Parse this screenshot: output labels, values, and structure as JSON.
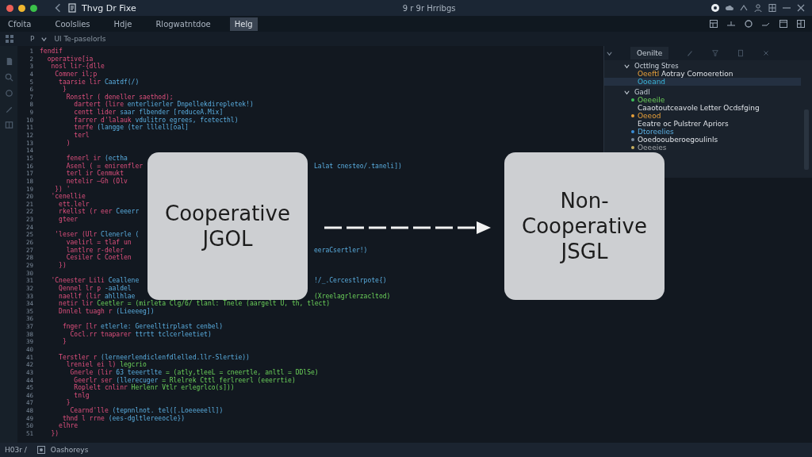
{
  "window": {
    "title": "Thvg Dr Fixe",
    "subtitle": "9 r 9r Hrribgs"
  },
  "menu": [
    {
      "label": "Cfoita",
      "selected": false
    },
    {
      "label": "Coolslies",
      "selected": false
    },
    {
      "label": "Hdje",
      "selected": false
    },
    {
      "label": "Rlogwatntdoe",
      "selected": false
    },
    {
      "label": "Helg",
      "selected": true
    }
  ],
  "toolbar": {
    "marker": "P",
    "breadcrumb": "Ul Te-paselorls"
  },
  "editor": {
    "lines": [
      {
        "number": "1",
        "parts": [
          {
            "text": "fendif",
            "kind": "keyword"
          }
        ]
      },
      {
        "number": "2",
        "parts": [
          {
            "text": "  operative[ia",
            "kind": "keyword"
          }
        ]
      },
      {
        "number": "3",
        "parts": [
          {
            "text": "   nosl lir-{dlle",
            "kind": "keyword"
          }
        ]
      },
      {
        "number": "4",
        "parts": [
          {
            "text": "    Comner il;p",
            "kind": "keyword"
          }
        ]
      },
      {
        "number": "5",
        "parts": [
          {
            "text": "     taarsie lir ",
            "kind": "keyword"
          },
          {
            "text": "Caatdf(/)",
            "kind": "string"
          }
        ]
      },
      {
        "number": "6",
        "parts": [
          {
            "text": "      }",
            "kind": "keyword"
          }
        ]
      },
      {
        "number": "7",
        "parts": [
          {
            "text": "       Ronstlr ( deneller saethod);",
            "kind": "keyword"
          }
        ]
      },
      {
        "number": "8",
        "parts": [
          {
            "text": "         dartert (lire ",
            "kind": "keyword"
          },
          {
            "text": "enterlierler Dnpellekdirepletek!)",
            "kind": "string"
          }
        ]
      },
      {
        "number": "9",
        "parts": [
          {
            "text": "         centt lider ",
            "kind": "keyword"
          },
          {
            "text": "saar flbender [reduceA.Mix]",
            "kind": "string"
          }
        ]
      },
      {
        "number": "10",
        "parts": [
          {
            "text": "         farrer d'lalauk ",
            "kind": "keyword"
          },
          {
            "text": "vdulitro egrees, fcetecthl)",
            "kind": "string"
          }
        ]
      },
      {
        "number": "11",
        "parts": [
          {
            "text": "         tnrfe ",
            "kind": "keyword"
          },
          {
            "text": "(langge (ter lllell[oal]",
            "kind": "string"
          }
        ]
      },
      {
        "number": "12",
        "parts": [
          {
            "text": "         terl",
            "kind": "keyword"
          }
        ]
      },
      {
        "number": "13",
        "parts": [
          {
            "text": "       )",
            "kind": "keyword"
          }
        ]
      },
      {
        "number": "14"
      },
      {
        "number": "15",
        "parts": [
          {
            "text": "       fenerl ir ",
            "kind": "keyword"
          },
          {
            "text": "(ectha",
            "kind": "string"
          }
        ]
      },
      {
        "number": "16",
        "parts": [
          {
            "text": "       Asenl ( = enirenfler",
            "kind": "keyword"
          }
        ],
        "tail": [
          {
            "text": "Lalat cnesteo/.taneli])",
            "kind": "string"
          }
        ]
      },
      {
        "number": "17",
        "parts": [
          {
            "text": "       terl ir Cenmukt",
            "kind": "keyword"
          }
        ]
      },
      {
        "number": "18",
        "parts": [
          {
            "text": "       netelir —Gh (Olv",
            "kind": "keyword"
          }
        ]
      },
      {
        "number": "19",
        "parts": [
          {
            "text": "    }) '",
            "kind": "keyword"
          }
        ]
      },
      {
        "number": "20",
        "parts": [
          {
            "text": "   'cenellie",
            "kind": "keyword"
          }
        ]
      },
      {
        "number": "21",
        "parts": [
          {
            "text": "     ett.lelr",
            "kind": "keyword"
          }
        ]
      },
      {
        "number": "22",
        "parts": [
          {
            "text": "     rkellst (r eer ",
            "kind": "keyword"
          },
          {
            "text": "Ceeerr",
            "kind": "string"
          }
        ]
      },
      {
        "number": "23",
        "parts": [
          {
            "text": "     gteer",
            "kind": "keyword"
          }
        ]
      },
      {
        "number": "24"
      },
      {
        "number": "25",
        "parts": [
          {
            "text": "    'leser (Ulr ",
            "kind": "keyword"
          },
          {
            "text": "Clenerle (",
            "kind": "string"
          }
        ]
      },
      {
        "number": "26",
        "parts": [
          {
            "text": "       vaelirl = tlaf un",
            "kind": "keyword"
          }
        ]
      },
      {
        "number": "27",
        "parts": [
          {
            "text": "       lantlre r-deler",
            "kind": "keyword"
          }
        ],
        "tail": [
          {
            "text": "eeraCsertler!)",
            "kind": "string"
          }
        ]
      },
      {
        "number": "28",
        "parts": [
          {
            "text": "       Cesiler C Coetlen",
            "kind": "keyword"
          }
        ]
      },
      {
        "number": "29",
        "parts": [
          {
            "text": "     })",
            "kind": "keyword"
          }
        ]
      },
      {
        "number": "30"
      },
      {
        "number": "31",
        "parts": [
          {
            "text": "   'Cneester Lili ",
            "kind": "keyword"
          },
          {
            "text": "Ceallene",
            "kind": "string"
          }
        ],
        "tail": [
          {
            "text": "!/_.Cercestlrpote{)",
            "kind": "string"
          }
        ]
      },
      {
        "number": "32",
        "parts": [
          {
            "text": "     Qennel lr p ",
            "kind": "keyword"
          },
          {
            "text": "-aaldel",
            "kind": "string"
          }
        ]
      },
      {
        "number": "33",
        "parts": [
          {
            "text": "     naellf (lir ",
            "kind": "keyword"
          },
          {
            "text": "ahllhlae",
            "kind": "string"
          }
        ],
        "tail": [
          {
            "text": "(Xreelagrlerzacltod)",
            "kind": "value"
          }
        ]
      },
      {
        "number": "34",
        "parts": [
          {
            "text": "     netir lir ",
            "kind": "keyword"
          },
          {
            "text": "Ceetler = (mirleta Clg/6/ tlanl: Tnele (aargelt U, th, tlect)",
            "kind": "value"
          }
        ]
      },
      {
        "number": "35",
        "parts": [
          {
            "text": "     Dnnlel tuagh r ",
            "kind": "keyword"
          },
          {
            "text": "(Lieeeeg])",
            "kind": "string"
          }
        ]
      },
      {
        "number": "36"
      },
      {
        "number": "37",
        "parts": [
          {
            "text": "      fnger [lr ",
            "kind": "keyword"
          },
          {
            "text": "etlerle: Gereelltirplast cenbel)",
            "kind": "string"
          }
        ]
      },
      {
        "number": "38",
        "parts": [
          {
            "text": "        Cocl.rr tnaparer ",
            "kind": "keyword"
          },
          {
            "text": "ttrtt tclcerleetiet)",
            "kind": "string"
          }
        ]
      },
      {
        "number": "39",
        "parts": [
          {
            "text": "      }",
            "kind": "keyword"
          }
        ]
      },
      {
        "number": "40"
      },
      {
        "number": "41",
        "parts": [
          {
            "text": "     Terstler r ",
            "kind": "keyword"
          },
          {
            "text": "(lerneerlendiclenfdlelled.llr-Slertie))",
            "kind": "string"
          }
        ]
      },
      {
        "number": "42",
        "parts": [
          {
            "text": "       lreniel ei l) ",
            "kind": "keyword"
          },
          {
            "text": "legcrio",
            "kind": "value"
          }
        ]
      },
      {
        "number": "43",
        "parts": [
          {
            "text": "        Gnerle (lir ",
            "kind": "keyword"
          },
          {
            "text": "63 teeertlte ",
            "kind": "string"
          },
          {
            "text": "= (atly,tleeL = cneertle, anltl = DDlSe)",
            "kind": "value"
          }
        ]
      },
      {
        "number": "44",
        "parts": [
          {
            "text": "         Geerlr ser ",
            "kind": "keyword"
          },
          {
            "text": "(llerecuger ",
            "kind": "string"
          },
          {
            "text": "= Rlelrek Cttl ferlreerl (eeerrtie)",
            "kind": "value"
          }
        ]
      },
      {
        "number": "45",
        "parts": [
          {
            "text": "         Roplelt cnlinr ",
            "kind": "keyword"
          },
          {
            "text": "Herlenr Vtlr erlegrlco(s]))",
            "kind": "value"
          }
        ]
      },
      {
        "number": "46",
        "parts": [
          {
            "text": "         tnlg",
            "kind": "keyword"
          }
        ]
      },
      {
        "number": "47",
        "parts": [
          {
            "text": "       }",
            "kind": "keyword"
          }
        ]
      },
      {
        "number": "48",
        "parts": [
          {
            "text": "        Cearnd'lle ",
            "kind": "keyword"
          },
          {
            "text": "(tepnnlnot. tel([.Loeeeeell])",
            "kind": "string"
          }
        ]
      },
      {
        "number": "49",
        "parts": [
          {
            "text": "      thnd l rrne ",
            "kind": "keyword"
          },
          {
            "text": "(ees-dgltlereeocle})",
            "kind": "string"
          }
        ]
      },
      {
        "number": "50",
        "parts": [
          {
            "text": "     elhre",
            "kind": "keyword"
          }
        ]
      },
      {
        "number": "51",
        "parts": [
          {
            "text": "   })",
            "kind": "keyword"
          }
        ]
      }
    ]
  },
  "outline": {
    "tab": "Oenilte",
    "groups": [
      {
        "label": "Octtlng Stres",
        "expanded": true,
        "items": [
          {
            "parts": [
              {
                "text": "Oeeftl ",
                "kind": "tag"
              },
              {
                "text": "Aotray Comoeretion",
                "kind": "text"
              }
            ],
            "selected": false
          },
          {
            "parts": [
              {
                "text": "Ooeand",
                "kind": "link"
              }
            ],
            "selected": true
          }
        ]
      },
      {
        "label": "Gadl",
        "expanded": true,
        "items": [
          {
            "color": "#3ec05a",
            "parts": [
              {
                "text": "Oeeeile",
                "kind": "value"
              }
            ],
            "selected": false
          },
          {
            "parts": [
              {
                "text": "Caaotoutceavole Letter Ocdsfging",
                "kind": "text"
              }
            ],
            "selected": false
          },
          {
            "color": "#e8a03a",
            "parts": [
              {
                "text": "Oeeod",
                "kind": "tag"
              }
            ],
            "selected": false
          },
          {
            "parts": [
              {
                "text": "Eeatre oc Pulstrer Apriors",
                "kind": "text"
              }
            ],
            "selected": false
          },
          {
            "color": "#3a8ed8",
            "parts": [
              {
                "text": "Dtoreelies",
                "kind": "string"
              }
            ],
            "selected": false
          },
          {
            "color": "#7a8ca0",
            "parts": [
              {
                "text": "Ooedoouberoegoulinls",
                "kind": "text"
              }
            ],
            "selected": false
          },
          {
            "color": "#c8b060",
            "parts": [
              {
                "text": "Oeeeies",
                "kind": "muted"
              }
            ],
            "selected": false
          }
        ]
      }
    ]
  },
  "diagram": {
    "boxes": [
      {
        "lines": [
          "Cooperative",
          "JGOL"
        ]
      },
      {
        "lines": [
          "Non-",
          "Cooperative",
          "JSGL"
        ]
      }
    ]
  },
  "status_bar": {
    "position": "H03r /",
    "label": "Oashoreys"
  }
}
